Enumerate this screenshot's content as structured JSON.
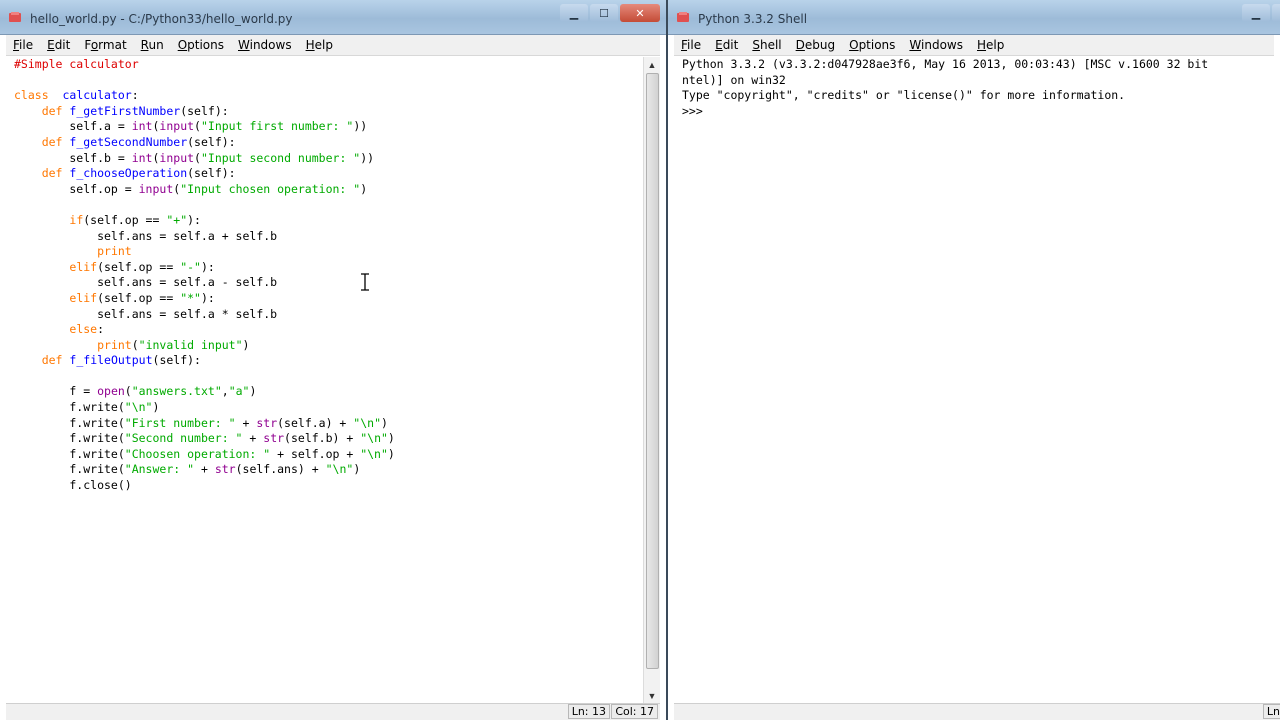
{
  "editor": {
    "title": "hello_world.py - C:/Python33/hello_world.py",
    "menu": [
      {
        "label": "File",
        "u": "F",
        "rest": "ile"
      },
      {
        "label": "Edit",
        "u": "E",
        "rest": "dit"
      },
      {
        "label": "Format",
        "pre": "F",
        "u": "o",
        "rest": "rmat"
      },
      {
        "label": "Run",
        "u": "R",
        "rest": "un"
      },
      {
        "label": "Options",
        "u": "O",
        "rest": "ptions"
      },
      {
        "label": "Windows",
        "u": "W",
        "rest": "indows"
      },
      {
        "label": "Help",
        "u": "H",
        "rest": "elp"
      }
    ],
    "code_lines": [
      [
        [
          "cm",
          "#Simple calculator"
        ]
      ],
      [],
      [
        [
          "kw",
          "class"
        ],
        [
          "",
          "  "
        ],
        [
          "fn",
          "calculator"
        ],
        [
          "",
          ":"
        ]
      ],
      [
        [
          "",
          "    "
        ],
        [
          "kw",
          "def"
        ],
        [
          "",
          " "
        ],
        [
          "fn",
          "f_getFirstNumber"
        ],
        [
          "",
          "(self):"
        ]
      ],
      [
        [
          "",
          "        self.a = "
        ],
        [
          "bi",
          "int"
        ],
        [
          "",
          "("
        ],
        [
          "bi",
          "input"
        ],
        [
          "",
          "("
        ],
        [
          "str",
          "\"Input first number: \""
        ],
        [
          "",
          "))"
        ]
      ],
      [
        [
          "",
          "    "
        ],
        [
          "kw",
          "def"
        ],
        [
          "",
          " "
        ],
        [
          "fn",
          "f_getSecondNumber"
        ],
        [
          "",
          "(self):"
        ]
      ],
      [
        [
          "",
          "        self.b = "
        ],
        [
          "bi",
          "int"
        ],
        [
          "",
          "("
        ],
        [
          "bi",
          "input"
        ],
        [
          "",
          "("
        ],
        [
          "str",
          "\"Input second number: \""
        ],
        [
          "",
          "))"
        ]
      ],
      [
        [
          "",
          "    "
        ],
        [
          "kw",
          "def"
        ],
        [
          "",
          " "
        ],
        [
          "fn",
          "f_chooseOperation"
        ],
        [
          "",
          "(self):"
        ]
      ],
      [
        [
          "",
          "        self.op = "
        ],
        [
          "bi",
          "input"
        ],
        [
          "",
          "("
        ],
        [
          "str",
          "\"Input chosen operation: \""
        ],
        [
          "",
          ")"
        ]
      ],
      [],
      [
        [
          "",
          "        "
        ],
        [
          "kw",
          "if"
        ],
        [
          "",
          "(self.op == "
        ],
        [
          "str",
          "\"+\""
        ],
        [
          "",
          "):"
        ]
      ],
      [
        [
          "",
          "            self.ans = self.a + self.b"
        ]
      ],
      [
        [
          "",
          "            "
        ],
        [
          "kw",
          "print"
        ]
      ],
      [
        [
          "",
          "        "
        ],
        [
          "kw",
          "elif"
        ],
        [
          "",
          "(self.op == "
        ],
        [
          "str",
          "\"-\""
        ],
        [
          "",
          "):"
        ]
      ],
      [
        [
          "",
          "            self.ans = self.a - self.b"
        ]
      ],
      [
        [
          "",
          "        "
        ],
        [
          "kw",
          "elif"
        ],
        [
          "",
          "(self.op == "
        ],
        [
          "str",
          "\"*\""
        ],
        [
          "",
          "):"
        ]
      ],
      [
        [
          "",
          "            self.ans = self.a * self.b"
        ]
      ],
      [
        [
          "",
          "        "
        ],
        [
          "kw",
          "else"
        ],
        [
          "",
          ":"
        ]
      ],
      [
        [
          "",
          "            "
        ],
        [
          "kw",
          "print"
        ],
        [
          "",
          "("
        ],
        [
          "str",
          "\"invalid input\""
        ],
        [
          "",
          ")"
        ]
      ],
      [
        [
          "",
          "    "
        ],
        [
          "kw",
          "def"
        ],
        [
          "",
          " "
        ],
        [
          "fn",
          "f_fileOutput"
        ],
        [
          "",
          "(self):"
        ]
      ],
      [],
      [
        [
          "",
          "        f = "
        ],
        [
          "bi",
          "open"
        ],
        [
          "",
          "("
        ],
        [
          "str",
          "\"answers.txt\""
        ],
        [
          "",
          ","
        ],
        [
          "str",
          "\"a\""
        ],
        [
          "",
          ")"
        ]
      ],
      [
        [
          "",
          "        f.write("
        ],
        [
          "str",
          "\"\\n\""
        ],
        [
          "",
          ")"
        ]
      ],
      [
        [
          "",
          "        f.write("
        ],
        [
          "str",
          "\"First number: \""
        ],
        [
          "",
          " + "
        ],
        [
          "bi",
          "str"
        ],
        [
          "",
          "(self.a) + "
        ],
        [
          "str",
          "\"\\n\""
        ],
        [
          "",
          ")"
        ]
      ],
      [
        [
          "",
          "        f.write("
        ],
        [
          "str",
          "\"Second number: \""
        ],
        [
          "",
          " + "
        ],
        [
          "bi",
          "str"
        ],
        [
          "",
          "(self.b) + "
        ],
        [
          "str",
          "\"\\n\""
        ],
        [
          "",
          ")"
        ]
      ],
      [
        [
          "",
          "        f.write("
        ],
        [
          "str",
          "\"Choosen operation: \""
        ],
        [
          "",
          " + self.op + "
        ],
        [
          "str",
          "\"\\n\""
        ],
        [
          "",
          ")"
        ]
      ],
      [
        [
          "",
          "        f.write("
        ],
        [
          "str",
          "\"Answer: \""
        ],
        [
          "",
          " + "
        ],
        [
          "bi",
          "str"
        ],
        [
          "",
          "(self.ans) + "
        ],
        [
          "str",
          "\"\\n\""
        ],
        [
          "",
          ")"
        ]
      ],
      [
        [
          "",
          "        f.close()"
        ]
      ]
    ],
    "status_ln": "Ln: 13",
    "status_col": "Col: 17"
  },
  "shell": {
    "title": "Python 3.3.2 Shell",
    "menu": [
      {
        "label": "File",
        "u": "F",
        "rest": "ile"
      },
      {
        "label": "Edit",
        "u": "E",
        "rest": "dit"
      },
      {
        "label": "Shell",
        "u": "S",
        "rest": "hell"
      },
      {
        "label": "Debug",
        "u": "D",
        "rest": "ebug"
      },
      {
        "label": "Options",
        "u": "O",
        "rest": "ptions"
      },
      {
        "label": "Windows",
        "u": "W",
        "rest": "indows"
      },
      {
        "label": "Help",
        "u": "H",
        "rest": "elp"
      }
    ],
    "output_lines": [
      "Python 3.3.2 (v3.3.2:d047928ae3f6, May 16 2013, 00:03:43) [MSC v.1600 32 bit",
      "ntel)] on win32",
      "Type \"copyright\", \"credits\" or \"license()\" for more information.",
      ">>> "
    ],
    "status_ln": "Ln"
  },
  "colors": {
    "keyword": "#ff7700",
    "definition": "#0000ff",
    "string": "#00aa00",
    "builtin": "#900090",
    "comment": "#dd0000"
  }
}
